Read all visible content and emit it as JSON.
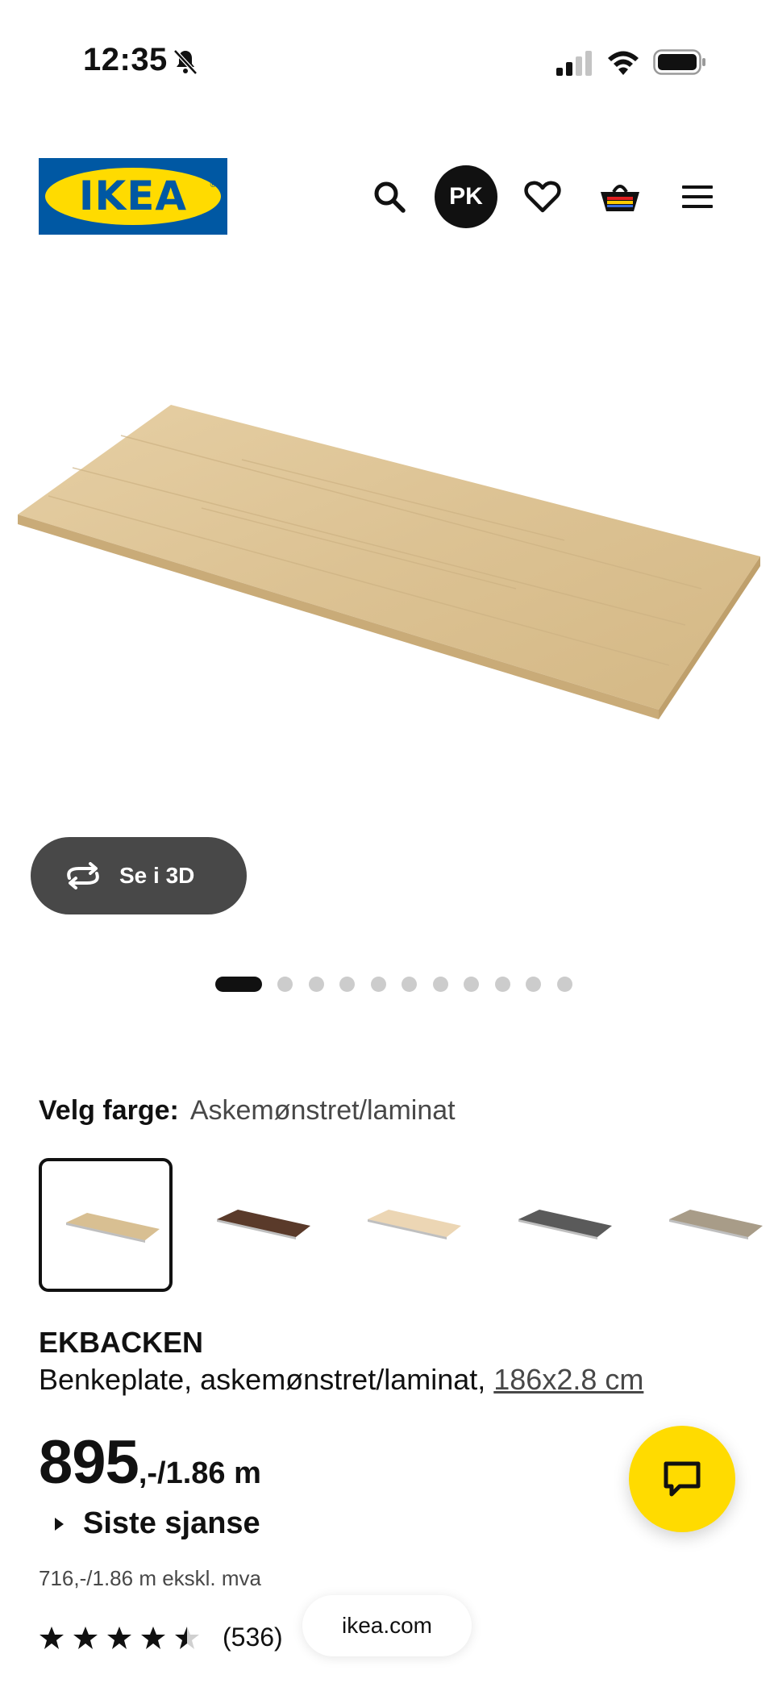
{
  "status_bar": {
    "time": "12:35",
    "icons": [
      "bell-off-icon",
      "cellular-signal-icon",
      "wifi-icon",
      "battery-icon"
    ]
  },
  "header": {
    "logo_text": "IKEA",
    "profile_initials": "PK",
    "icons": [
      "search-icon",
      "heart-icon",
      "shopping-basket-icon",
      "hamburger-menu-icon"
    ]
  },
  "gallery": {
    "view_3d_label": "Se i 3D",
    "dot_count": 11,
    "active_dot": 1
  },
  "color": {
    "label": "Velg farge:",
    "value": "Askemønstret/laminat",
    "swatches": [
      {
        "color": "#d8bf92",
        "selected": true
      },
      {
        "color": "#5a3a2a",
        "selected": false
      },
      {
        "color": "#ecd6b4",
        "selected": false
      },
      {
        "color": "#5a5a5a",
        "selected": false
      },
      {
        "color": "#a89c88",
        "selected": false
      }
    ]
  },
  "product": {
    "name": "EKBACKEN",
    "description": "Benkeplate, askemønstret/laminat, ",
    "size_link": "186x2.8 cm",
    "price_main": "895",
    "price_unit": ",-/1.86 m",
    "last_chance": "Siste sjanse",
    "price_ex_vat": "716,-/1.86 m ekskl. mva",
    "rating": 4.5,
    "review_count": "(536)"
  },
  "chat": {
    "icon": "chat-bubble-icon"
  },
  "browser": {
    "url": "ikea.com"
  },
  "colors": {
    "ikea_blue": "#0058a3",
    "ikea_yellow": "#ffdb00",
    "dark": "#111111"
  }
}
